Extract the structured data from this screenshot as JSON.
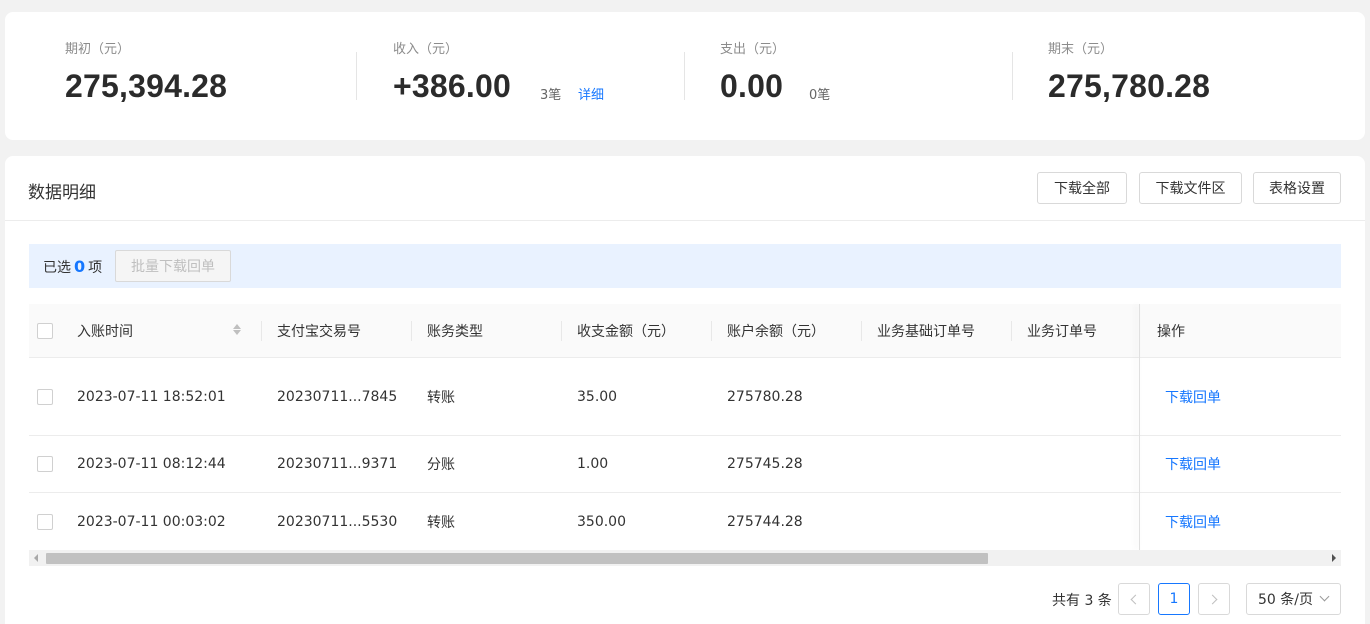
{
  "summary": {
    "opening": {
      "label": "期初（元）",
      "value": "275,394.28"
    },
    "income": {
      "label": "收入（元）",
      "value": "+386.00",
      "count": "3笔",
      "detail_link": "详细"
    },
    "expense": {
      "label": "支出（元）",
      "value": "0.00",
      "count": "0笔"
    },
    "closing": {
      "label": "期末（元）",
      "value": "275,780.28"
    }
  },
  "panel": {
    "title": "数据明细",
    "buttons": {
      "download_all": "下载全部",
      "download_area": "下载文件区",
      "table_settings": "表格设置"
    }
  },
  "selection": {
    "prefix": "已选",
    "count": "0",
    "suffix": "项",
    "batch_button": "批量下载回单"
  },
  "table": {
    "columns": [
      "入账时间",
      "支付宝交易号",
      "账务类型",
      "收支金额（元）",
      "账户余额（元）",
      "业务基础订单号",
      "业务订单号",
      "操作"
    ],
    "rows": [
      {
        "time": "2023-07-11 18:52:01",
        "trade_no": "20230711...7845",
        "type": "转账",
        "amount": "35.00",
        "balance": "275780.28",
        "action": "下载回单"
      },
      {
        "time": "2023-07-11 08:12:44",
        "trade_no": "20230711...9371",
        "type": "分账",
        "amount": "1.00",
        "balance": "275745.28",
        "action": "下载回单"
      },
      {
        "time": "2023-07-11 00:03:02",
        "trade_no": "20230711...5530",
        "type": "转账",
        "amount": "350.00",
        "balance": "275744.28",
        "action": "下载回单"
      }
    ]
  },
  "pagination": {
    "total": "共有 3 条",
    "current_page": "1",
    "page_size": "50 条/页"
  },
  "colors": {
    "accent": "#1677ff",
    "selection_bg": "#e9f2ff"
  }
}
